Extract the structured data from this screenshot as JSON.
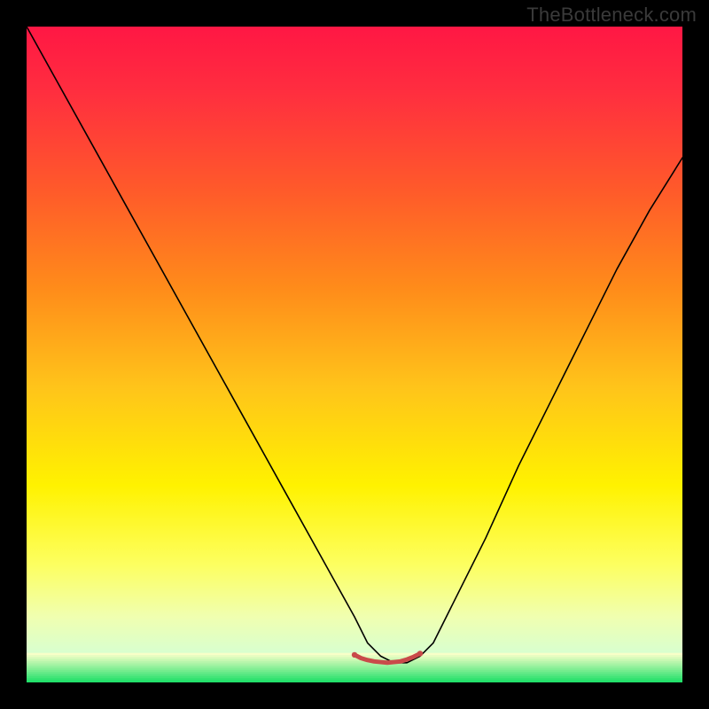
{
  "watermark": "TheBottleneck.com",
  "chart_data": {
    "type": "line",
    "title": "",
    "xlabel": "",
    "ylabel": "",
    "xlim": [
      0,
      100
    ],
    "ylim": [
      0,
      100
    ],
    "gradient_stops": [
      {
        "offset": 0.0,
        "color": "#ff1744"
      },
      {
        "offset": 0.1,
        "color": "#ff2e3f"
      },
      {
        "offset": 0.25,
        "color": "#ff5a2a"
      },
      {
        "offset": 0.4,
        "color": "#ff8c1a"
      },
      {
        "offset": 0.55,
        "color": "#ffc41a"
      },
      {
        "offset": 0.7,
        "color": "#fff200"
      },
      {
        "offset": 0.82,
        "color": "#fdff60"
      },
      {
        "offset": 0.9,
        "color": "#f0ffb0"
      },
      {
        "offset": 0.955,
        "color": "#d8ffcf"
      },
      {
        "offset": 1.0,
        "color": "#22e06a"
      }
    ],
    "bottom_band": {
      "y_start": 95.5,
      "y_end": 100,
      "stripe_count": 14
    },
    "series": [
      {
        "name": "bottleneck-curve",
        "color": "#000000",
        "stroke_width": 1.6,
        "x": [
          0,
          5,
          10,
          15,
          20,
          25,
          30,
          35,
          40,
          45,
          50,
          52,
          54,
          56,
          58,
          60,
          62,
          65,
          70,
          75,
          80,
          85,
          90,
          95,
          100
        ],
        "values": [
          100,
          91,
          82,
          73,
          64,
          55,
          46,
          37,
          28,
          19,
          10,
          6,
          4,
          3,
          3,
          4,
          6,
          12,
          22,
          33,
          43,
          53,
          63,
          72,
          80
        ]
      },
      {
        "name": "optimal-marker",
        "color": "#c94a4a",
        "stroke_width": 5,
        "x": [
          50,
          51,
          52,
          53,
          54,
          55,
          56,
          57,
          58,
          59,
          60
        ],
        "values": [
          4.2,
          3.7,
          3.4,
          3.2,
          3.1,
          3.0,
          3.1,
          3.2,
          3.5,
          3.9,
          4.4
        ]
      }
    ],
    "marker_caps": [
      {
        "x": 50,
        "y": 4.2,
        "r": 3.2,
        "color": "#c94a4a"
      },
      {
        "x": 60,
        "y": 4.4,
        "r": 3.2,
        "color": "#c94a4a"
      }
    ],
    "annotations": []
  }
}
